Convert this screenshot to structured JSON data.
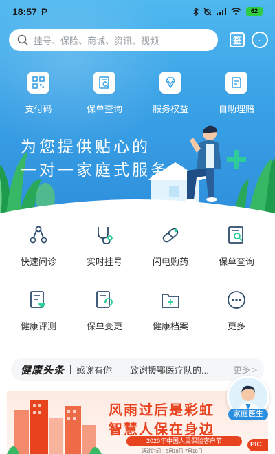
{
  "status_bar": {
    "time": "18:57",
    "app_indicator": "P",
    "battery": "62"
  },
  "search": {
    "placeholder": "挂号、保险、商城、资讯、视频",
    "sign_label": "签"
  },
  "hero": {
    "items": [
      {
        "label": "支付码",
        "icon": "qr-code-icon"
      },
      {
        "label": "保单查询",
        "icon": "policy-search-icon"
      },
      {
        "label": "服务权益",
        "icon": "diamond-icon"
      },
      {
        "label": "自助理赔",
        "icon": "claim-icon"
      }
    ],
    "slogan_line1": "为您提供贴心的",
    "slogan_line2": "一对一家庭式服务"
  },
  "services": {
    "row1": [
      {
        "label": "快速问诊",
        "icon": "consult-icon"
      },
      {
        "label": "实时挂号",
        "icon": "stethoscope-icon"
      },
      {
        "label": "闪电购药",
        "icon": "pill-icon"
      },
      {
        "label": "保单查询",
        "icon": "policy-search-icon"
      }
    ],
    "row2": [
      {
        "label": "健康评测",
        "icon": "health-test-icon"
      },
      {
        "label": "保单变更",
        "icon": "policy-change-icon"
      },
      {
        "label": "健康档案",
        "icon": "health-file-icon"
      },
      {
        "label": "更多",
        "icon": "more-icon"
      }
    ]
  },
  "headline": {
    "brand": "健康头条",
    "text": "感谢有你——致谢援鄂医疗队的...",
    "more": "更多 >"
  },
  "banner": {
    "title1": "风雨过后是彩虹",
    "title2": "智慧人保在身边",
    "subtitle": "2020年中国人民保险客户节",
    "date": "活动时间：5月18日-7月18日",
    "tag": "PIC"
  },
  "doctor": {
    "label": "家庭医生"
  },
  "colors": {
    "primary_blue": "#3aa2e6",
    "accent_green": "#2ecc9a",
    "banner_red": "#e8431f"
  }
}
